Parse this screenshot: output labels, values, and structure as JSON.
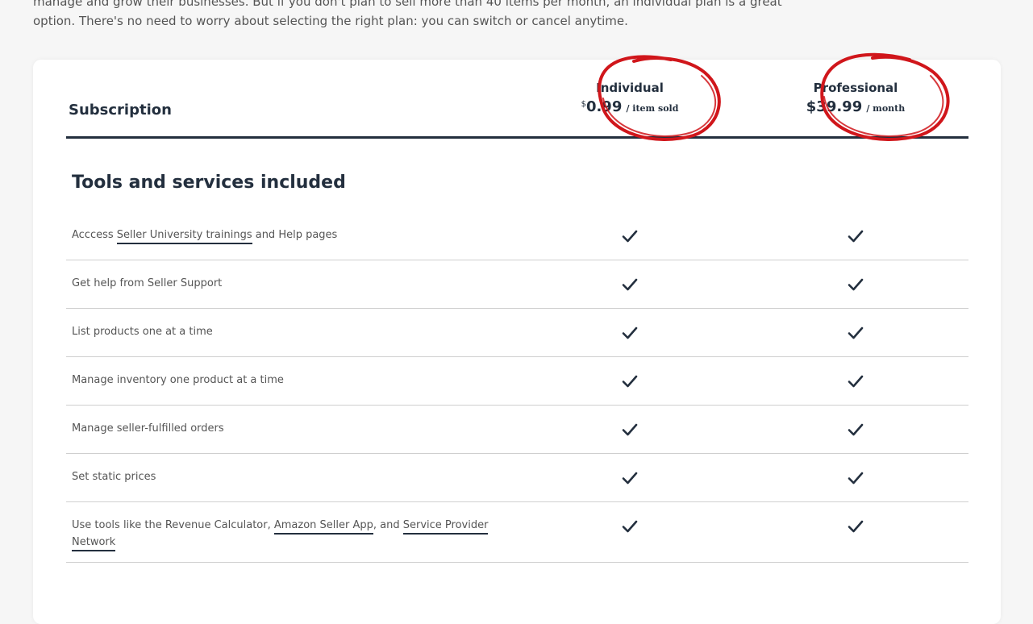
{
  "intro": {
    "line1": "manage and grow their businesses. But if you don't plan to sell more than 40 items per month, an individual plan is a great",
    "line2": "option. There's no need to worry about selecting the right plan: you can switch or cancel anytime."
  },
  "table": {
    "header_label": "Subscription",
    "plans": [
      {
        "name": "Individual",
        "currency_symbol": "$",
        "price": "0.99",
        "unit": "/ item sold"
      },
      {
        "name": "Professional",
        "currency_symbol": "",
        "price": "$39.99",
        "unit": "/ month"
      }
    ]
  },
  "section": {
    "title": "Tools and services included"
  },
  "features": [
    {
      "before": "Acccess ",
      "link1": "Seller University trainings",
      "middle": " and Help pages",
      "link2": "",
      "after": "",
      "link3": "",
      "end": ""
    },
    {
      "before": "Get help from Seller Support",
      "link1": "",
      "middle": "",
      "link2": "",
      "after": "",
      "link3": "",
      "end": ""
    },
    {
      "before": "List products one at a time",
      "link1": "",
      "middle": "",
      "link2": "",
      "after": "",
      "link3": "",
      "end": ""
    },
    {
      "before": "Manage inventory one product at a time",
      "link1": "",
      "middle": "",
      "link2": "",
      "after": "",
      "link3": "",
      "end": ""
    },
    {
      "before": "Manage seller-fulfilled orders",
      "link1": "",
      "middle": "",
      "link2": "",
      "after": "",
      "link3": "",
      "end": ""
    },
    {
      "before": "Set static prices",
      "link1": "",
      "middle": "",
      "link2": "",
      "after": "",
      "link3": "",
      "end": ""
    },
    {
      "before": "Use tools like the Revenue Calculator, ",
      "link1": "Amazon Seller App",
      "middle": ", and ",
      "link2": "Service Provider",
      "after": " ",
      "link3": "Network",
      "end": ""
    }
  ],
  "colors": {
    "text_dark": "#232f3e",
    "text_muted": "#555555",
    "annotation_red": "#d0161b",
    "divider": "#cfcfcf"
  },
  "icons": {
    "check": "checkmark-icon"
  }
}
